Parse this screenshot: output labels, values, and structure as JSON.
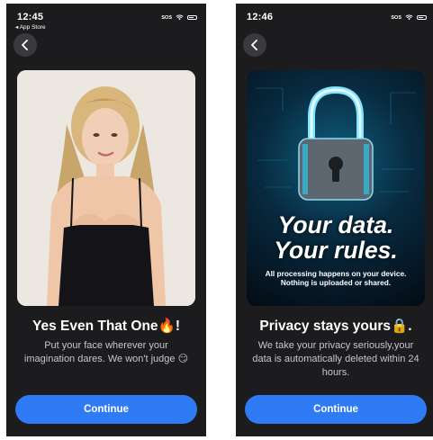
{
  "left": {
    "time": "12:45",
    "back_to_app": "◂ App Store",
    "sos": "SOS",
    "headline": "Yes Even That One🔥!",
    "body": "Put your face wherever your imagination dares. We won't judge 😏",
    "continue_label": "Continue"
  },
  "right": {
    "time": "12:46",
    "sos": "SOS",
    "hero_title_line1": "Your data.",
    "hero_title_line2": "Your rules.",
    "hero_subtitle": "All processing happens on your device. Nothing is uploaded or shared.",
    "headline": "Privacy stays yours🔒.",
    "body": "We take your privacy seriously,your data is automatically deleted within 24 hours.",
    "continue_label": "Continue"
  },
  "icons": {
    "back": "chevron-left-icon",
    "wifi": "wifi-icon",
    "battery": "battery-icon",
    "lock": "padlock-icon"
  },
  "colors": {
    "background": "#1c1c1e",
    "button": "#2f7bf5",
    "back_button": "#3a3a3c"
  }
}
